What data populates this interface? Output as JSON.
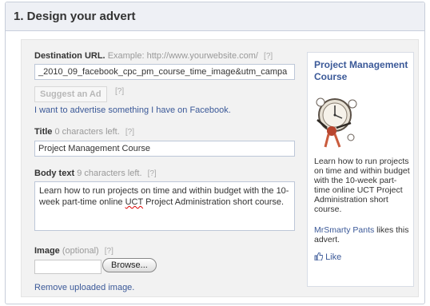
{
  "section": {
    "title": "1. Design your advert"
  },
  "form": {
    "destination": {
      "label": "Destination URL.",
      "hint": "Example: http://www.yourwebsite.com/",
      "help": "[?]",
      "value": "_2010_09_facebook_cpc_pm_course_time_image&utm_campa"
    },
    "suggest": {
      "label": "Suggest an Ad",
      "help": "[?]"
    },
    "advertise_link": "I want to advertise something I have on Facebook.",
    "title": {
      "label": "Title",
      "hint": "0 characters left.",
      "help": "[?]",
      "value": "Project Management Course"
    },
    "body": {
      "label": "Body text",
      "hint": "9 characters left.",
      "help": "[?]",
      "value_before": "Learn how to run projects on time and within budget with the 10-week part-time online ",
      "value_misspelled": "UCT",
      "value_after": " Project Administration short course."
    },
    "image": {
      "label": "Image",
      "hint": "(optional)",
      "help": "[?]",
      "browse_label": "Browse...",
      "remove_link": "Remove uploaded image."
    }
  },
  "preview": {
    "title": "Project Management Course",
    "body": "Learn how to run projects on time and within budget with the 10-week part-time online UCT Project Administration short course.",
    "social_name": "MrSmarty Pants",
    "social_text": " likes this advert.",
    "like_label": "Like",
    "image_icon": "clock-juggler-image"
  },
  "colors": {
    "link": "#3b5998",
    "header_bg": "#eef0f5",
    "panel_bg": "#f2f2f2"
  }
}
